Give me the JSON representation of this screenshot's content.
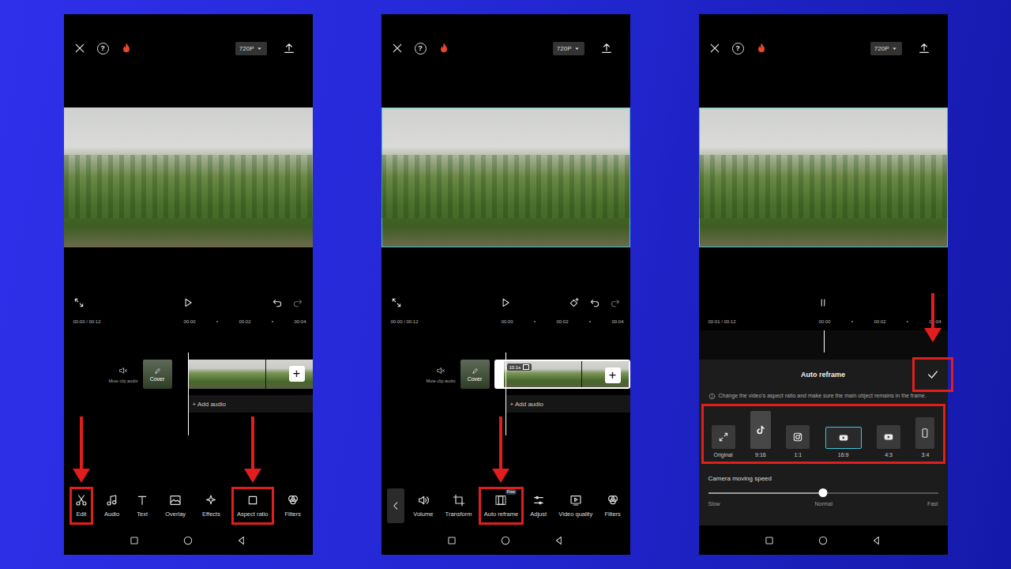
{
  "screens": [
    {
      "kind": "editor",
      "top_bar": {
        "help": "?",
        "resolution": "720P"
      },
      "video": {
        "selected": false
      },
      "controls": {
        "playing": false,
        "show_tools": true,
        "keyframe": false,
        "redo_enabled": false
      },
      "timeline": {
        "time": "00:00 / 00:12",
        "ticks": [
          "00:00",
          "00:02",
          "00:04"
        ]
      },
      "tracks": {
        "mute_label": "Mute clip audio",
        "cover_label": "Cover",
        "add_clip": "+",
        "add_audio": "+ Add audio",
        "clip_selected": false
      },
      "toolbar": {
        "back": false,
        "items": [
          {
            "label": "Edit",
            "kind": "edit",
            "highlighted": true,
            "arrow": true
          },
          {
            "label": "Audio",
            "kind": "audio",
            "highlighted": false,
            "arrow": false
          },
          {
            "label": "Text",
            "kind": "text",
            "highlighted": false,
            "arrow": false
          },
          {
            "label": "Overlay",
            "kind": "overlay",
            "highlighted": false,
            "arrow": false
          },
          {
            "label": "Effects",
            "kind": "effects",
            "highlighted": false,
            "arrow": false
          },
          {
            "label": "Aspect ratio",
            "kind": "aspect",
            "highlighted": true,
            "arrow": true
          },
          {
            "label": "Filters",
            "kind": "filters",
            "highlighted": false,
            "arrow": false
          }
        ]
      }
    },
    {
      "kind": "editor",
      "top_bar": {
        "help": "?",
        "resolution": "720P"
      },
      "video": {
        "selected": true
      },
      "controls": {
        "playing": false,
        "show_tools": true,
        "keyframe": true,
        "redo_enabled": false
      },
      "timeline": {
        "time": "00:00 / 00:12",
        "ticks": [
          "00:00",
          "00:02",
          "00:04"
        ]
      },
      "tracks": {
        "mute_label": "Mute clip audio",
        "cover_label": "Cover",
        "add_clip": "+",
        "add_audio": "+ Add audio",
        "clip_selected": true,
        "clip_badge": "10.1s"
      },
      "toolbar": {
        "back": true,
        "items": [
          {
            "label": "Volume",
            "kind": "volume",
            "highlighted": false,
            "arrow": false
          },
          {
            "label": "Transform",
            "kind": "transform",
            "highlighted": false,
            "arrow": false
          },
          {
            "label": "Auto reframe",
            "kind": "reframe",
            "badge": "Free",
            "highlighted": true,
            "arrow": true
          },
          {
            "label": "Adjust",
            "kind": "adjust",
            "highlighted": false,
            "arrow": false
          },
          {
            "label": "Video quality",
            "kind": "quality",
            "highlighted": false,
            "arrow": false
          },
          {
            "label": "Filters",
            "kind": "filters",
            "highlighted": false,
            "arrow": false
          }
        ]
      }
    },
    {
      "kind": "reframe",
      "top_bar": {
        "help": "?",
        "resolution": "720P"
      },
      "video": {
        "selected": true
      },
      "controls": {
        "playing": true,
        "show_tools": false
      },
      "timeline": {
        "time": "00:01 / 00:12",
        "ticks": [
          "00:00",
          "00:02",
          "00:04"
        ]
      },
      "sheet": {
        "title": "Auto reframe",
        "confirm": {
          "highlighted": true,
          "arrow": true
        },
        "info": "Change the video's aspect ratio and make sure the main object remains in the frame.",
        "options_highlighted": true,
        "options": [
          {
            "label": "Original",
            "kind": "original",
            "selected": false
          },
          {
            "label": "9:16",
            "kind": "tiktok",
            "selected": false
          },
          {
            "label": "1:1",
            "kind": "instagram",
            "selected": false
          },
          {
            "label": "16:9",
            "kind": "youtube",
            "selected": true
          },
          {
            "label": "4:3",
            "kind": "youtube",
            "selected": false
          },
          {
            "label": "3:4",
            "kind": "portrait",
            "selected": false
          }
        ],
        "speed": {
          "label": "Camera moving speed",
          "level": 0.5,
          "marks": [
            "Slow",
            "Normal",
            "Fast"
          ]
        }
      }
    }
  ]
}
